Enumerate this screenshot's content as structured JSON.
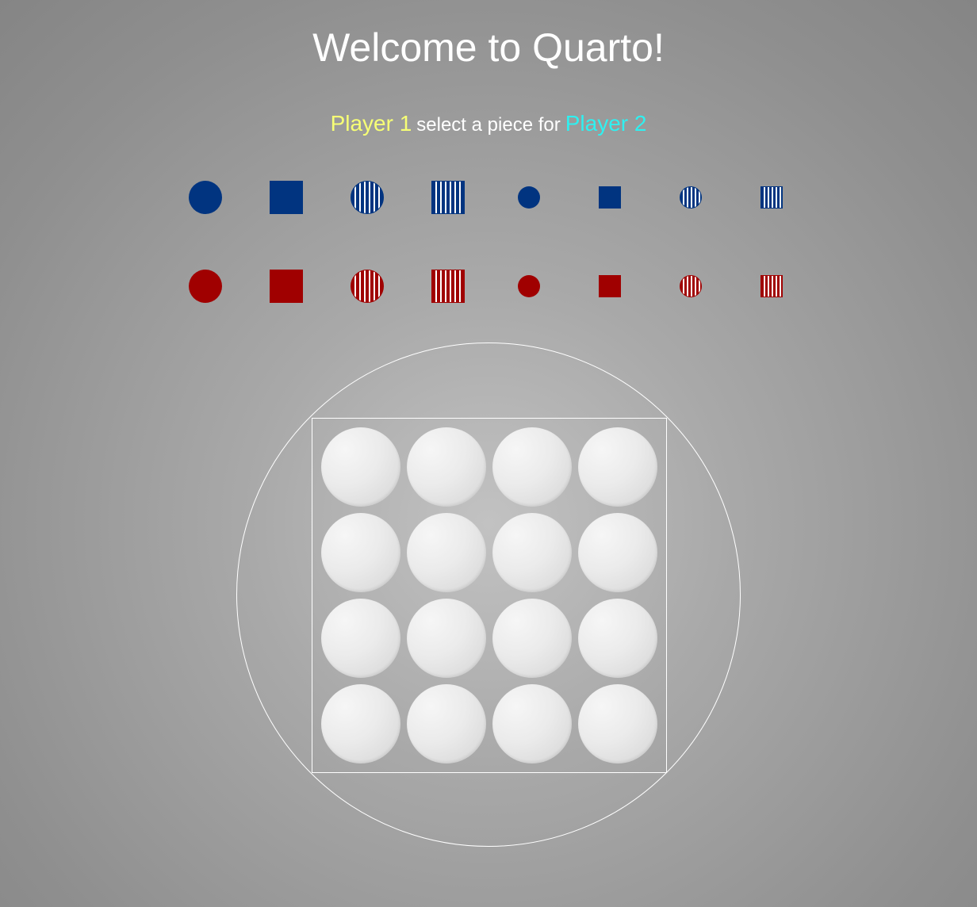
{
  "title": "Welcome to Quarto!",
  "status": {
    "current_player": "Player 1",
    "message": "select a piece for",
    "next_player": "Player 2"
  },
  "colors": {
    "blue_piece": "#013480",
    "red_piece": "#a00000",
    "player1_text": "#f7ff75",
    "player2_text": "#2ff0f0"
  },
  "available_pieces": [
    {
      "color": "blue",
      "shape": "round",
      "size": "tall",
      "fill": "solid"
    },
    {
      "color": "blue",
      "shape": "square",
      "size": "tall",
      "fill": "solid"
    },
    {
      "color": "blue",
      "shape": "round",
      "size": "tall",
      "fill": "striped"
    },
    {
      "color": "blue",
      "shape": "square",
      "size": "tall",
      "fill": "striped"
    },
    {
      "color": "blue",
      "shape": "round",
      "size": "short",
      "fill": "solid"
    },
    {
      "color": "blue",
      "shape": "square",
      "size": "short",
      "fill": "solid"
    },
    {
      "color": "blue",
      "shape": "round",
      "size": "short",
      "fill": "striped"
    },
    {
      "color": "blue",
      "shape": "square",
      "size": "short",
      "fill": "striped"
    },
    {
      "color": "red",
      "shape": "round",
      "size": "tall",
      "fill": "solid"
    },
    {
      "color": "red",
      "shape": "square",
      "size": "tall",
      "fill": "solid"
    },
    {
      "color": "red",
      "shape": "round",
      "size": "tall",
      "fill": "striped"
    },
    {
      "color": "red",
      "shape": "square",
      "size": "tall",
      "fill": "striped"
    },
    {
      "color": "red",
      "shape": "round",
      "size": "short",
      "fill": "solid"
    },
    {
      "color": "red",
      "shape": "square",
      "size": "short",
      "fill": "solid"
    },
    {
      "color": "red",
      "shape": "round",
      "size": "short",
      "fill": "striped"
    },
    {
      "color": "red",
      "shape": "square",
      "size": "short",
      "fill": "striped"
    }
  ],
  "board": {
    "rows": 4,
    "cols": 4,
    "cells": [
      [
        "empty",
        "empty",
        "empty",
        "empty"
      ],
      [
        "empty",
        "empty",
        "empty",
        "empty"
      ],
      [
        "empty",
        "empty",
        "empty",
        "empty"
      ],
      [
        "empty",
        "empty",
        "empty",
        "empty"
      ]
    ]
  }
}
